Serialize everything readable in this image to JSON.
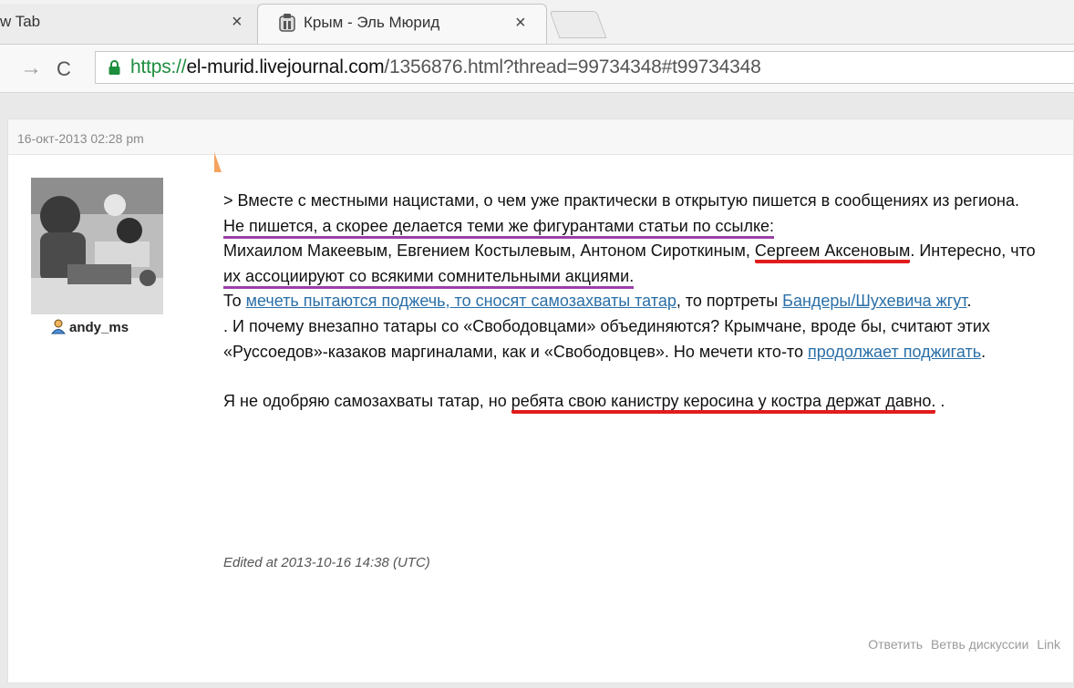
{
  "browser": {
    "tabs": [
      {
        "title": "w Tab",
        "close": "×"
      },
      {
        "title": "Крым - Эль Мюрид",
        "close": "×"
      }
    ],
    "url": {
      "scheme": "https://",
      "host": "el-murid.livejournal.com",
      "path": "/1356876.html?thread=99734348#t99734348"
    },
    "nav": {
      "forward": "→",
      "reload": "C"
    }
  },
  "comment": {
    "date": "16-окт-2013 02:28 pm",
    "username": "andy_ms",
    "body": {
      "quote": "> Вместе с местными нацистами, о чем уже практически в открытую пишется в сообщениях из региона.",
      "p2_underlined": "Не пишется, а скорее делается теми же фигурантами статьи по ссылке:",
      "p2_names": "Михаилом Макеевым, Евгением Костылевым, Антоном Сироткиным, ",
      "p2_red1": "Сергеем Аксеновым",
      "p2_after_red1": ". Интересно, что ",
      "p2_purple": "их ассоциируют со всякими сомнительными акциями.",
      "p3_to1": "То ",
      "p3_link1": "мечеть пытаются поджечь, то сносят самозахваты татар",
      "p3_mid": ", то портреты ",
      "p3_link2": "Бандеры/Шухевича жгут",
      "p3_end": ".",
      "p4": ". И почему внезапно татары со «Свободовцами» объединяются? Крымчане, вроде бы, считают этих «Руссоедов»-казаков маргиналами, как и «Свободовцев». Но мечети кто-то ",
      "p4_link": "продолжает поджигать",
      "p4_end": ".",
      "p5_start": "Я не одобряю самозахваты татар, но ",
      "p5_red": "ребята свою канистру керосина у костра держат давно.",
      "p5_end": " ."
    },
    "edited": "Edited at 2013-10-16 14:38 (UTC)",
    "actions": {
      "reply": "Ответить",
      "thread": "Ветвь дискуссии",
      "link": "Link"
    }
  },
  "colors": {
    "link": "#2a6fa8",
    "underline_red": "#e11c1c",
    "underline_purple": "#9b3fa8",
    "secure_green": "#1e8e3e"
  }
}
